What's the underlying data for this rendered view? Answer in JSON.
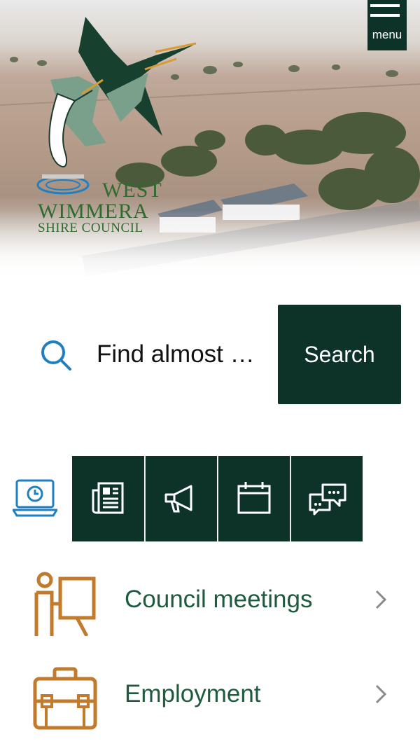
{
  "header": {
    "menu_label": "menu",
    "logo": {
      "line1": "WEST",
      "line2": "WIMMERA",
      "line3": "SHIRE COUNCIL"
    }
  },
  "search": {
    "placeholder": "Find almost …",
    "button_label": "Search",
    "icon": "search-icon"
  },
  "quick_tabs": [
    {
      "icon": "laptop-clock-icon",
      "active": true
    },
    {
      "icon": "newspaper-icon"
    },
    {
      "icon": "megaphone-icon"
    },
    {
      "icon": "calendar-icon"
    },
    {
      "icon": "chat-bubbles-icon"
    }
  ],
  "list": [
    {
      "label": "Council meetings",
      "icon": "presenter-board-icon"
    },
    {
      "label": "Employment",
      "icon": "briefcase-icon"
    }
  ],
  "colors": {
    "brand_dark_green": "#0d3328",
    "text_green": "#1e5a3d",
    "accent_orange": "#c27a2c",
    "accent_blue": "#1f7fc0",
    "logo_green": "#2e6b2f"
  }
}
